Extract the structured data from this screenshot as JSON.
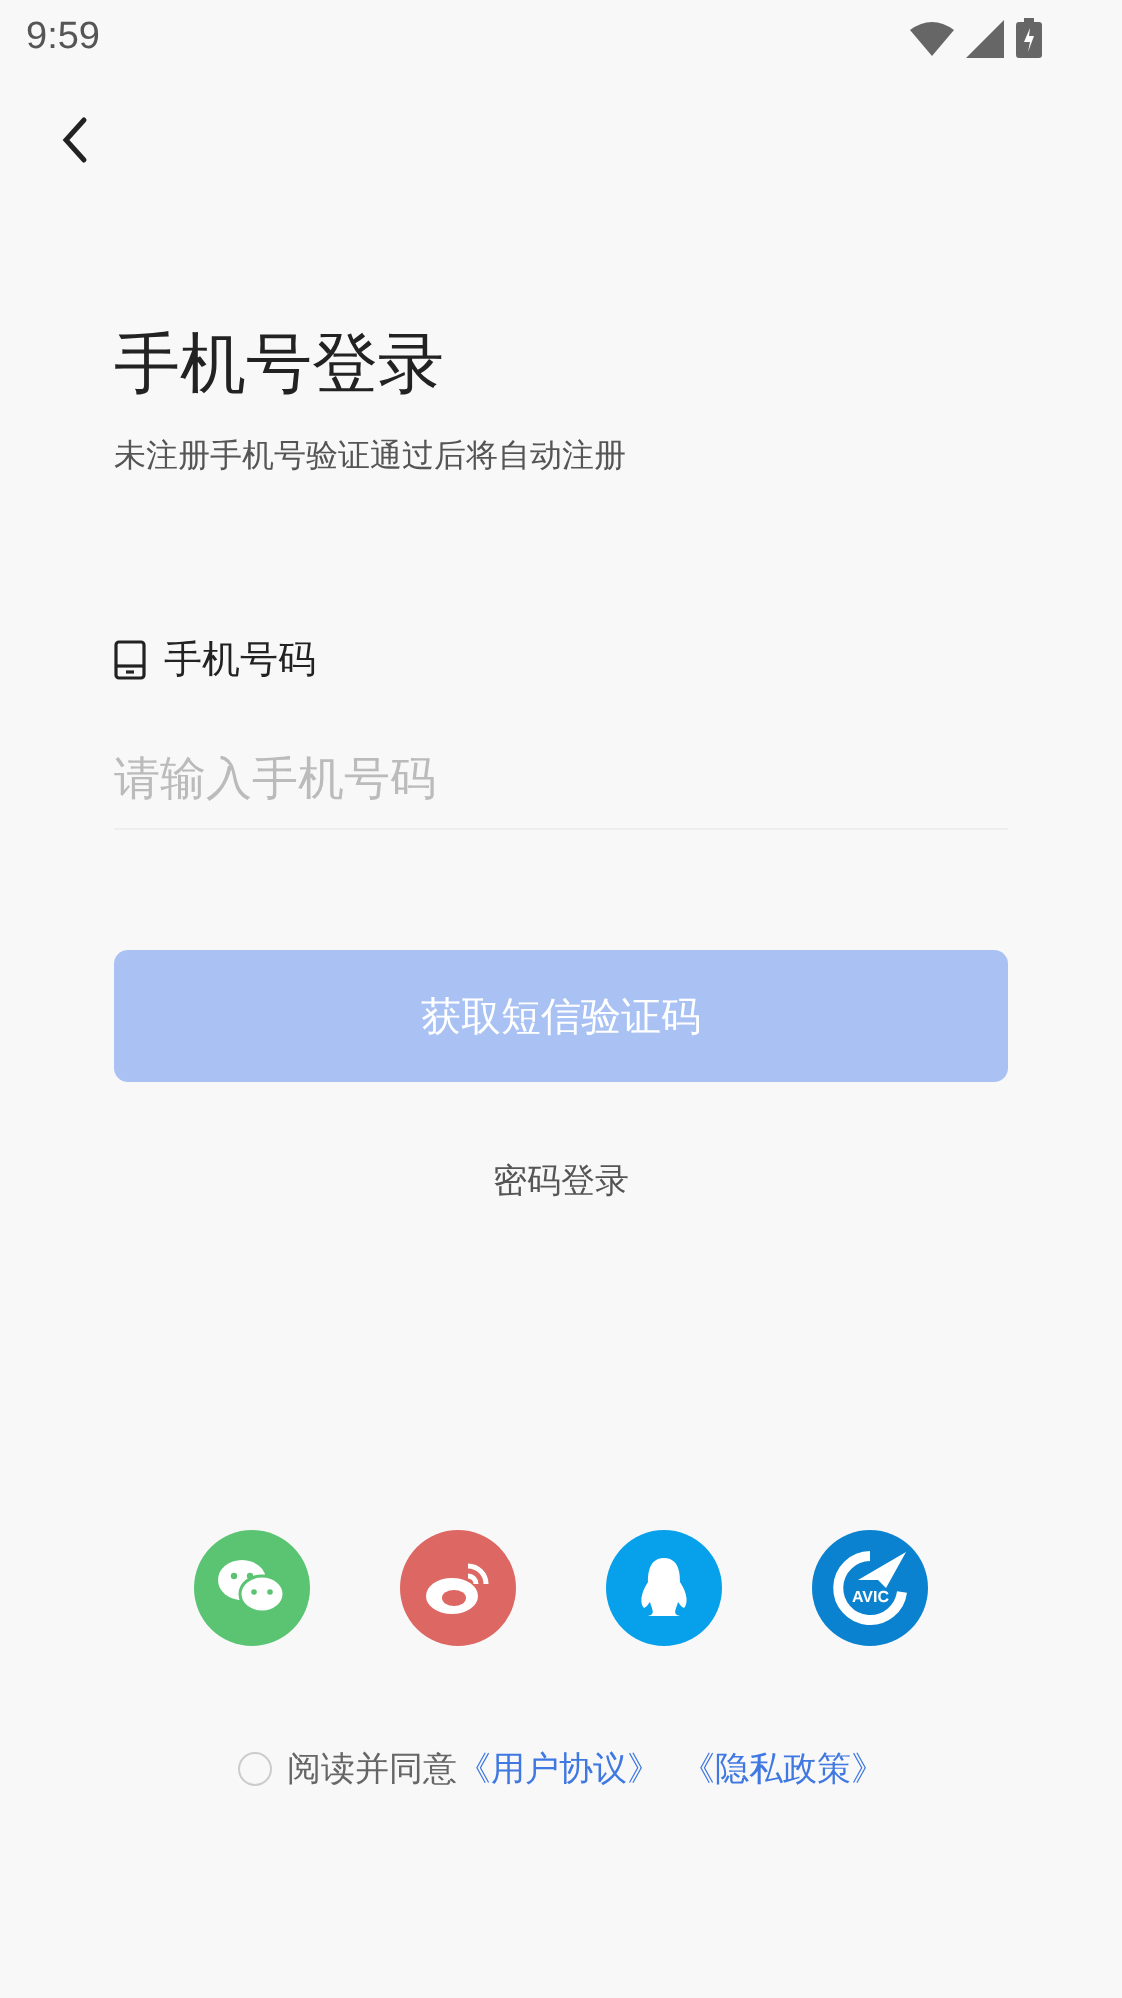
{
  "status_bar": {
    "time": "9:59"
  },
  "title": "手机号登录",
  "subtitle": "未注册手机号验证通过后将自动注册",
  "phone_field": {
    "label": "手机号码",
    "placeholder": "请输入手机号码"
  },
  "submit_button": {
    "label": "获取短信验证码",
    "disabled": true
  },
  "password_login_link": "密码登录",
  "social_logins": [
    {
      "kind": "chat",
      "color": "#5ac472"
    },
    {
      "kind": "eye",
      "color": "#dd6762"
    },
    {
      "kind": "penguin",
      "color": "#07a0eb"
    },
    {
      "kind": "plane",
      "color": "#0b82cf",
      "label": "AVIC"
    }
  ],
  "agreement": {
    "checked": false,
    "text": "阅读并同意",
    "links": [
      "《用户协议》",
      "《隐私政策》"
    ]
  }
}
